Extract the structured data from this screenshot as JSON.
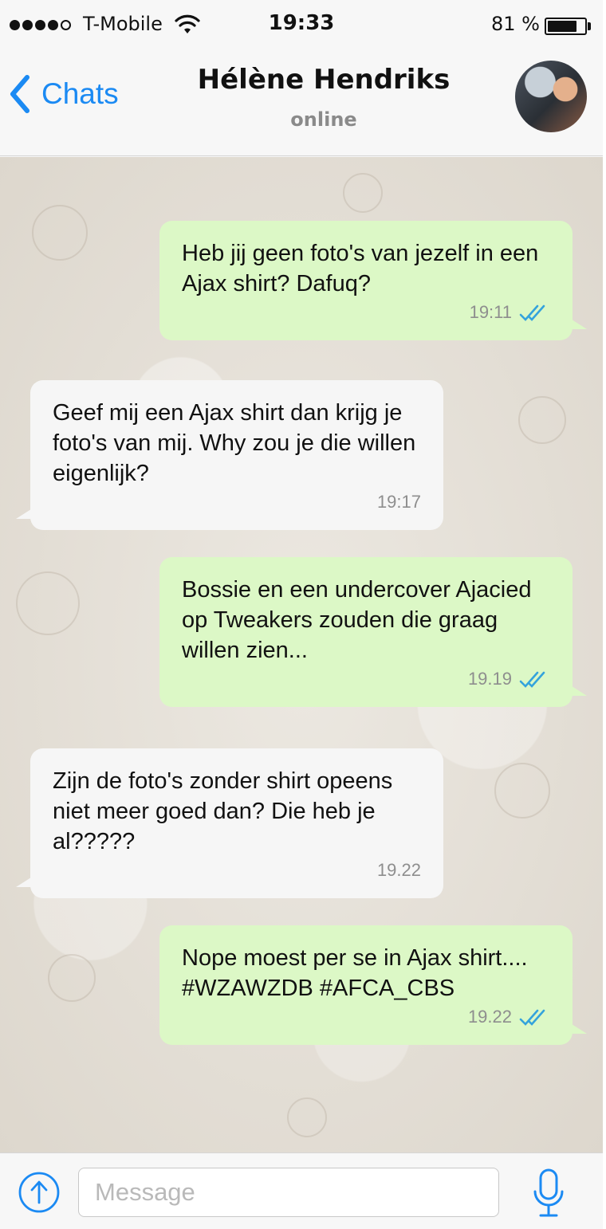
{
  "status_bar": {
    "carrier": "T-Mobile",
    "time": "19:33",
    "battery_percent": "81 %",
    "battery_level": 0.81,
    "signal_bars": 4,
    "signal_max": 5
  },
  "nav": {
    "back_label": "Chats",
    "contact_name": "Hélène Hendriks",
    "contact_status": "online"
  },
  "messages": [
    {
      "direction": "outgoing",
      "text": "Heb jij geen foto's van jezelf in een Ajax shirt? Dafuq?",
      "time": "19:11",
      "read_ticks": true
    },
    {
      "direction": "incoming",
      "text": "Geef mij een Ajax shirt dan krijg je foto's van mij. Why zou je die willen eigenlijk?",
      "time": "19:17",
      "read_ticks": false
    },
    {
      "direction": "outgoing",
      "text": "Bossie en een undercover Ajacied op Tweakers zouden die graag willen zien...",
      "time": "19.19",
      "read_ticks": true
    },
    {
      "direction": "incoming",
      "text": "Zijn de foto's zonder shirt opeens niet meer goed dan? Die heb je al?????",
      "time": "19.22",
      "read_ticks": false
    },
    {
      "direction": "outgoing",
      "text": "Nope moest per se in Ajax shirt.... #WZAWZDB #AFCA_CBS",
      "time": "19.22",
      "read_ticks": true
    }
  ],
  "input": {
    "placeholder": "Message",
    "value": ""
  },
  "icons": {
    "back": "chevron-left-icon",
    "share": "upload-circle-icon",
    "mic": "microphone-icon",
    "ticks": "double-check-icon"
  },
  "colors": {
    "accent": "#1b8af3",
    "outgoing_bubble": "#dcf8c6",
    "incoming_bubble": "#f6f6f6",
    "tick_blue": "#34a3dc"
  }
}
